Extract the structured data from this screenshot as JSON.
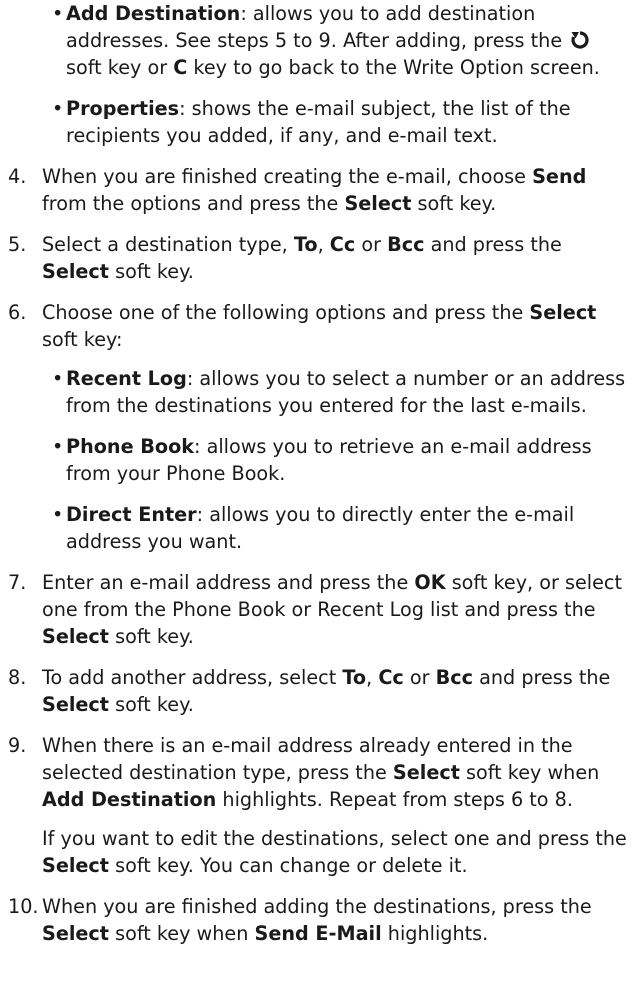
{
  "top_bullets": [
    {
      "bold": "Add Destination",
      "text_a": ": allows you to add destination addresses. See steps 5 to 9. After adding, press the",
      "icon": "back-arrow-icon",
      "text_b": "soft key or",
      "bold_b": "C",
      "text_c": "key to go back to the Write Option screen."
    },
    {
      "bold": "Properties",
      "text": ": shows the e-mail subject, the list of the recipients you added, if any, and e-mail text."
    }
  ],
  "step4": {
    "num": "4.",
    "a": "When you are finished creating the e-mail, choose",
    "b1": "Send",
    "c": "from the options and press the",
    "b2": "Select",
    "d": "soft key."
  },
  "step5": {
    "num": "5.",
    "a": "Select a destination type,",
    "b1": "To",
    "sep1": ",",
    "b2": "Cc",
    "or": "or",
    "b3": "Bcc",
    "c": "and press the",
    "b4": "Select",
    "d": "soft key."
  },
  "step6": {
    "num": "6.",
    "a": "Choose one of the following options and press the",
    "b1": "Select",
    "d": "soft key:",
    "bullets": [
      {
        "bold": "Recent Log",
        "text": ": allows you to select a number or an address from the destinations you entered for the last e-mails."
      },
      {
        "bold": "Phone Book",
        "text": ": allows you to retrieve an e-mail address from your Phone Book."
      },
      {
        "bold": "Direct Enter",
        "text": ": allows you to directly enter the e-mail address you want."
      }
    ]
  },
  "step7": {
    "num": "7.",
    "a": "Enter an e-mail address and press the",
    "b1": "OK",
    "c": "soft key, or select one from the Phone Book or Recent Log list and press the",
    "b2": "Select",
    "d": "soft key."
  },
  "step8": {
    "num": "8.",
    "a": "To add another address, select",
    "b1": "To",
    "sep1": ",",
    "b2": "Cc",
    "or": "or",
    "b3": "Bcc",
    "c": "and press the",
    "b4": "Select",
    "d": "soft key."
  },
  "step9": {
    "num": "9.",
    "a": "When there is an e-mail address already entered in the selected destination type, press the",
    "b1": "Select",
    "c": "soft key when",
    "b2": "Add Destination",
    "d": "highlights. Repeat from steps 6 to 8.",
    "sub_a": "If you want to edit the destinations, select one and press the",
    "sub_b": "Select",
    "sub_c": "soft key. You can change or delete it."
  },
  "step10": {
    "num": "10.",
    "a": "When you are finished adding the destinations, press the",
    "b1": "Select",
    "c": "soft key when",
    "b2": "Send E-Mail",
    "d": "highlights."
  }
}
